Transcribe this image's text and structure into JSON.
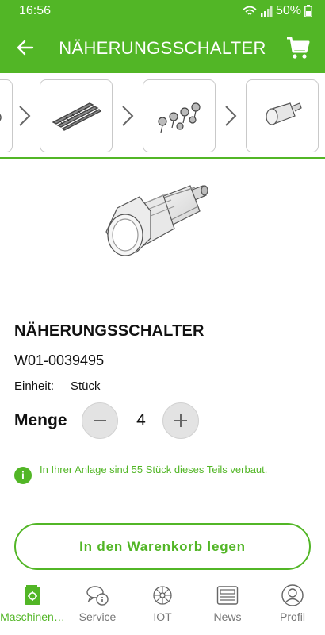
{
  "status_bar": {
    "time": "16:56",
    "battery": "50%"
  },
  "app_bar": {
    "title": "NÄHERUNGSSCHALTER"
  },
  "breadcrumb": {
    "items": [
      "item-partial",
      "rail",
      "fastener-set",
      "proximity-switch"
    ]
  },
  "product": {
    "name": "NÄHERUNGSSCHALTER",
    "number": "W01-0039495",
    "unit_label": "Einheit:",
    "unit_value": "Stück",
    "quantity_label": "Menge",
    "quantity": "4",
    "info": "In Ihrer Anlage sind 55 Stück dieses Teils verbaut.",
    "add_to_cart": "In den Warenkorb legen"
  },
  "nav": {
    "items": [
      {
        "label": "Maschinen…",
        "icon": "machine-book-icon",
        "active": true
      },
      {
        "label": "Service",
        "icon": "service-chat-icon",
        "active": false
      },
      {
        "label": "IOT",
        "icon": "iot-network-icon",
        "active": false
      },
      {
        "label": "News",
        "icon": "news-icon",
        "active": false
      },
      {
        "label": "Profil",
        "icon": "profile-icon",
        "active": false
      }
    ]
  },
  "colors": {
    "accent": "#52b626",
    "text": "#111111",
    "muted": "#777777"
  }
}
